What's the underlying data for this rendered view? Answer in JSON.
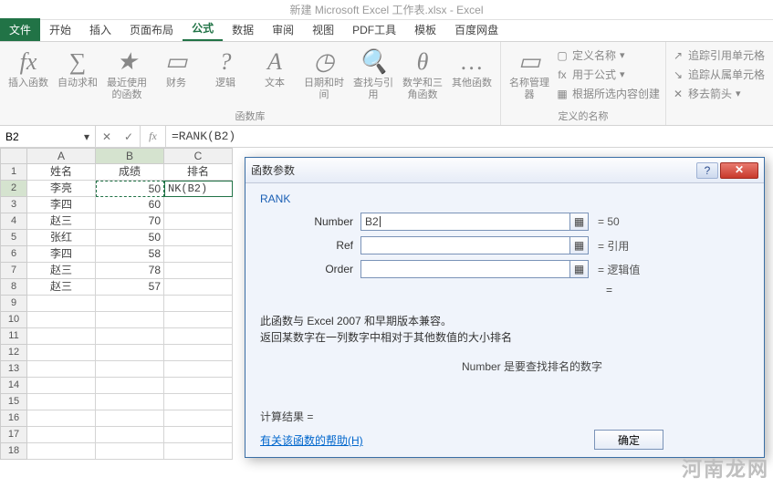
{
  "title": "新建 Microsoft Excel 工作表.xlsx - Excel",
  "tabs": {
    "file": "文件",
    "start": "开始",
    "insert": "插入",
    "layout": "页面布局",
    "formula": "公式",
    "data": "数据",
    "review": "审阅",
    "view": "视图",
    "pdf": "PDF工具",
    "template": "模板",
    "baidu": "百度网盘"
  },
  "ribbon": {
    "insert_fn": "插入函数",
    "autosum": "自动求和",
    "recent": "最近使用的函数",
    "finance": "财务",
    "logic": "逻辑",
    "text": "文本",
    "datetime": "日期和时间",
    "lookup": "查找与引用",
    "math": "数学和三角函数",
    "other": "其他函数",
    "name_mgr": "名称管理器",
    "def_name": "定义名称",
    "use_in_formula": "用于公式",
    "create_from_sel": "根据所选内容创建",
    "trace_prec": "追踪引用单元格",
    "trace_dep": "追踪从属单元格",
    "remove_arrows": "移去箭头",
    "grp_fnlib": "函数库",
    "grp_names": "定义的名称"
  },
  "namebox": "B2",
  "formula_bar": "=RANK(B2)",
  "cols": [
    "A",
    "B",
    "C"
  ],
  "sheet": {
    "h": {
      "a": "姓名",
      "b": "成绩",
      "c": "排名"
    },
    "r2": {
      "a": "李亮",
      "b": "50",
      "c": "NK(B2)"
    },
    "r3": {
      "a": "李四",
      "b": "60"
    },
    "r4": {
      "a": "赵三",
      "b": "70"
    },
    "r5": {
      "a": "张红",
      "b": "50"
    },
    "r6": {
      "a": "李四",
      "b": "58"
    },
    "r7": {
      "a": "赵三",
      "b": "78"
    },
    "r8": {
      "a": "赵三",
      "b": "57"
    }
  },
  "dialog": {
    "title": "函数参数",
    "fn": "RANK",
    "args": {
      "number": {
        "label": "Number",
        "value": "B2",
        "result": "= 50"
      },
      "ref": {
        "label": "Ref",
        "value": "",
        "result": "= 引用"
      },
      "order": {
        "label": "Order",
        "value": "",
        "result": "= 逻辑值"
      }
    },
    "eq": "=",
    "desc1": "此函数与 Excel 2007 和早期版本兼容。",
    "desc2": "返回某数字在一列数字中相对于其他数值的大小排名",
    "arg_desc": "Number  是要查找排名的数字",
    "result_label": "计算结果 =",
    "help_link": "有关该函数的帮助(H)",
    "ok": "确定"
  },
  "watermark": "河南龙网"
}
